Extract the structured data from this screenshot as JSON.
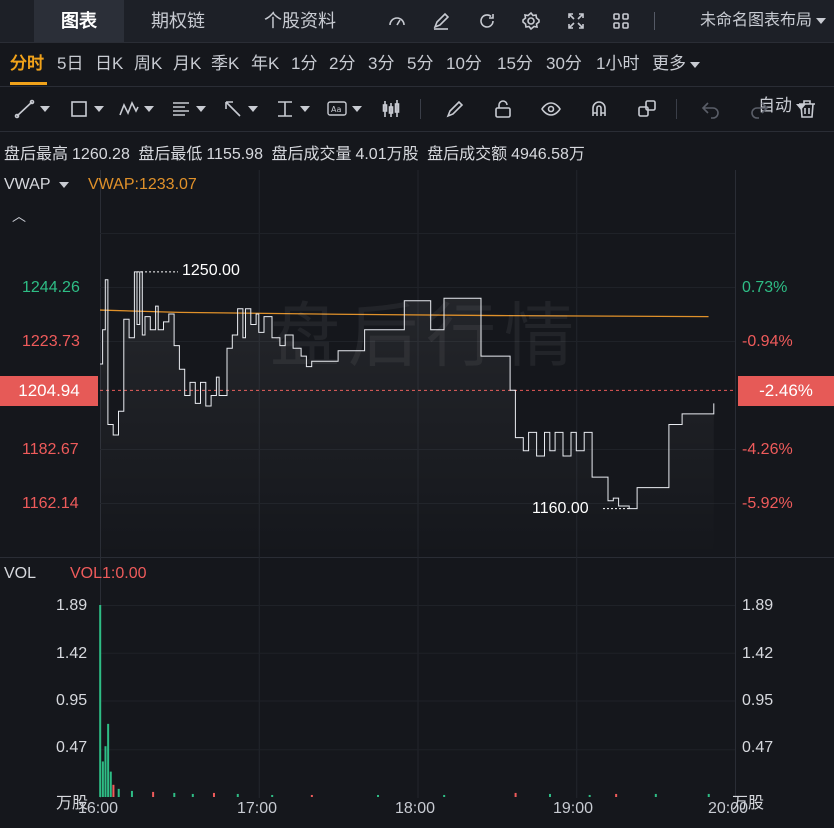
{
  "top_tabs": [
    "图表",
    "期权链",
    "个股资料"
  ],
  "active_top_tab": "图表",
  "layout_name": "未命名图表布局",
  "top_icons": [
    "gauge-icon",
    "edit-icon",
    "refresh-icon",
    "settings-icon",
    "fullscreen-icon",
    "grid-icon"
  ],
  "periods": [
    "分时",
    "5日",
    "日K",
    "周K",
    "月K",
    "季K",
    "年K",
    "1分",
    "2分",
    "3分",
    "5分",
    "10分",
    "15分",
    "30分",
    "1小时",
    "更多"
  ],
  "active_period": "分时",
  "scale_mode": "自动",
  "tools": [
    "line-tool-icon",
    "rect-tool-icon",
    "wave-tool-icon",
    "fib-tool-icon",
    "arrow-tool-icon",
    "measure-tool-icon",
    "text-tool-icon",
    "candle-tool-icon",
    "pen-icon",
    "lock-icon",
    "eye-icon",
    "magnet-icon",
    "clone-icon",
    "undo-icon",
    "redo-icon",
    "trash-icon"
  ],
  "stats": {
    "high_label": "盘后最高",
    "high": "1260.28",
    "low_label": "盘后最低",
    "low": "1155.98",
    "vol_label": "盘后成交量",
    "vol": "4.01万股",
    "amt_label": "盘后成交额",
    "amt": "4946.58万"
  },
  "indicator": {
    "name": "VWAP",
    "value_text": "VWAP:1233.07"
  },
  "watermark": "盘后行情",
  "price_axis_left": [
    "1244.26",
    "1223.73",
    "1182.67",
    "1162.14"
  ],
  "price_axis_right": [
    "0.73%",
    "-0.94%",
    "-4.26%",
    "-5.92%"
  ],
  "current_price": "1204.94",
  "current_pct": "-2.46%",
  "high_annotation": "1250.00",
  "low_annotation": "1160.00",
  "volume": {
    "name": "VOL",
    "value_text": "VOL1:0.00",
    "axis": [
      "1.89",
      "1.42",
      "0.95",
      "0.47"
    ],
    "unit": "万股"
  },
  "x_axis": [
    "16:00",
    "17:00",
    "18:00",
    "19:00",
    "20:00"
  ],
  "colors": {
    "up": "#2ebd85",
    "down": "#ef5b5b",
    "vwap": "#e0912a",
    "accent": "#f0a21a",
    "price": "#e9ecf1"
  },
  "chart_data": {
    "type": "line",
    "x_range": [
      "16:00",
      "20:00"
    ],
    "price_range": [
      1150,
      1260
    ],
    "vwap": 1233.07,
    "price_series": [
      {
        "t": "16:00",
        "p": 1215
      },
      {
        "t": "16:01",
        "p": 1228
      },
      {
        "t": "16:02",
        "p": 1247
      },
      {
        "t": "16:03",
        "p": 1192
      },
      {
        "t": "16:05",
        "p": 1188
      },
      {
        "t": "16:07",
        "p": 1197
      },
      {
        "t": "16:09",
        "p": 1232
      },
      {
        "t": "16:11",
        "p": 1225
      },
      {
        "t": "16:13",
        "p": 1250
      },
      {
        "t": "16:14",
        "p": 1230
      },
      {
        "t": "16:15",
        "p": 1250
      },
      {
        "t": "16:16",
        "p": 1226
      },
      {
        "t": "16:17",
        "p": 1233
      },
      {
        "t": "16:19",
        "p": 1228
      },
      {
        "t": "16:21",
        "p": 1237
      },
      {
        "t": "16:22",
        "p": 1228
      },
      {
        "t": "16:24",
        "p": 1231
      },
      {
        "t": "16:26",
        "p": 1234
      },
      {
        "t": "16:28",
        "p": 1222
      },
      {
        "t": "16:30",
        "p": 1213
      },
      {
        "t": "16:32",
        "p": 1203
      },
      {
        "t": "16:34",
        "p": 1208
      },
      {
        "t": "16:36",
        "p": 1200
      },
      {
        "t": "16:38",
        "p": 1208
      },
      {
        "t": "16:40",
        "p": 1199
      },
      {
        "t": "16:42",
        "p": 1203
      },
      {
        "t": "16:44",
        "p": 1210
      },
      {
        "t": "16:45",
        "p": 1203
      },
      {
        "t": "16:48",
        "p": 1221
      },
      {
        "t": "16:50",
        "p": 1226
      },
      {
        "t": "16:52",
        "p": 1236
      },
      {
        "t": "16:54",
        "p": 1225
      },
      {
        "t": "16:55",
        "p": 1236
      },
      {
        "t": "16:57",
        "p": 1230
      },
      {
        "t": "16:59",
        "p": 1234
      },
      {
        "t": "17:00",
        "p": 1227
      },
      {
        "t": "17:02",
        "p": 1233
      },
      {
        "t": "17:05",
        "p": 1225
      },
      {
        "t": "17:08",
        "p": 1222
      },
      {
        "t": "17:10",
        "p": 1226
      },
      {
        "t": "17:13",
        "p": 1221
      },
      {
        "t": "17:16",
        "p": 1218
      },
      {
        "t": "17:18",
        "p": 1214
      },
      {
        "t": "17:20",
        "p": 1216
      },
      {
        "t": "17:25",
        "p": 1216
      },
      {
        "t": "17:30",
        "p": 1220
      },
      {
        "t": "17:35",
        "p": 1220
      },
      {
        "t": "17:40",
        "p": 1228
      },
      {
        "t": "17:50",
        "p": 1228
      },
      {
        "t": "17:55",
        "p": 1239
      },
      {
        "t": "18:00",
        "p": 1239
      },
      {
        "t": "18:05",
        "p": 1228
      },
      {
        "t": "18:10",
        "p": 1240
      },
      {
        "t": "18:20",
        "p": 1240
      },
      {
        "t": "18:24",
        "p": 1218
      },
      {
        "t": "18:30",
        "p": 1218
      },
      {
        "t": "18:35",
        "p": 1205
      },
      {
        "t": "18:37",
        "p": 1187
      },
      {
        "t": "18:40",
        "p": 1182
      },
      {
        "t": "18:42",
        "p": 1189
      },
      {
        "t": "18:45",
        "p": 1180
      },
      {
        "t": "18:48",
        "p": 1189
      },
      {
        "t": "18:50",
        "p": 1182
      },
      {
        "t": "18:52",
        "p": 1189
      },
      {
        "t": "18:55",
        "p": 1180
      },
      {
        "t": "18:58",
        "p": 1189
      },
      {
        "t": "19:00",
        "p": 1182
      },
      {
        "t": "19:03",
        "p": 1189
      },
      {
        "t": "19:06",
        "p": 1172
      },
      {
        "t": "19:10",
        "p": 1172
      },
      {
        "t": "19:12",
        "p": 1163
      },
      {
        "t": "19:14",
        "p": 1164
      },
      {
        "t": "19:16",
        "p": 1161
      },
      {
        "t": "19:20",
        "p": 1160
      },
      {
        "t": "19:23",
        "p": 1168
      },
      {
        "t": "19:30",
        "p": 1168
      },
      {
        "t": "19:35",
        "p": 1192
      },
      {
        "t": "19:40",
        "p": 1196
      },
      {
        "t": "19:45",
        "p": 1196
      },
      {
        "t": "19:50",
        "p": 1196
      },
      {
        "t": "19:52",
        "p": 1200
      }
    ],
    "volume_series": [
      {
        "t": "16:00",
        "v": 1.89,
        "c": "up"
      },
      {
        "t": "16:01",
        "v": 0.35,
        "c": "up"
      },
      {
        "t": "16:02",
        "v": 0.5,
        "c": "up"
      },
      {
        "t": "16:03",
        "v": 0.72,
        "c": "up"
      },
      {
        "t": "16:04",
        "v": 0.25,
        "c": "up"
      },
      {
        "t": "16:05",
        "v": 0.12,
        "c": "down"
      },
      {
        "t": "16:07",
        "v": 0.08,
        "c": "up"
      },
      {
        "t": "16:12",
        "v": 0.06,
        "c": "up"
      },
      {
        "t": "16:20",
        "v": 0.05,
        "c": "down"
      },
      {
        "t": "16:28",
        "v": 0.04,
        "c": "up"
      },
      {
        "t": "16:35",
        "v": 0.03,
        "c": "up"
      },
      {
        "t": "16:43",
        "v": 0.04,
        "c": "down"
      },
      {
        "t": "16:52",
        "v": 0.03,
        "c": "up"
      },
      {
        "t": "17:05",
        "v": 0.02,
        "c": "up"
      },
      {
        "t": "17:20",
        "v": 0.02,
        "c": "down"
      },
      {
        "t": "17:45",
        "v": 0.02,
        "c": "up"
      },
      {
        "t": "18:10",
        "v": 0.02,
        "c": "up"
      },
      {
        "t": "18:37",
        "v": 0.04,
        "c": "down"
      },
      {
        "t": "18:50",
        "v": 0.03,
        "c": "up"
      },
      {
        "t": "19:05",
        "v": 0.02,
        "c": "up"
      },
      {
        "t": "19:15",
        "v": 0.03,
        "c": "down"
      },
      {
        "t": "19:30",
        "v": 0.03,
        "c": "up"
      },
      {
        "t": "19:50",
        "v": 0.03,
        "c": "up"
      }
    ]
  }
}
